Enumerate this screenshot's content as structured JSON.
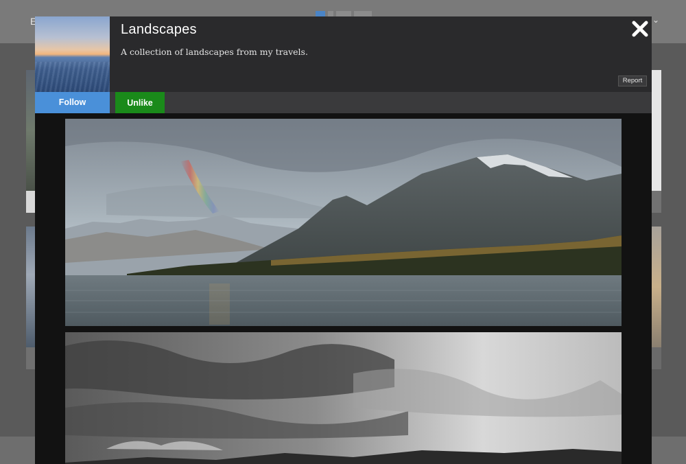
{
  "background": {
    "nav_left_text": "E",
    "chevron_icon": "chevron-down-icon"
  },
  "modal": {
    "title": "Landscapes",
    "description": "A collection of landscapes from my travels.",
    "close_icon": "close-icon",
    "report_label": "Report",
    "follow_label": "Follow",
    "unlike_label": "Unlike",
    "colors": {
      "follow": "#4a90d9",
      "unlike": "#1a8a1a",
      "header_bg": "#2a2a2c"
    },
    "photos": [
      {
        "name": "rainbow-mountain-lake-photo"
      },
      {
        "name": "black-white-storm-clouds-photo"
      }
    ]
  }
}
